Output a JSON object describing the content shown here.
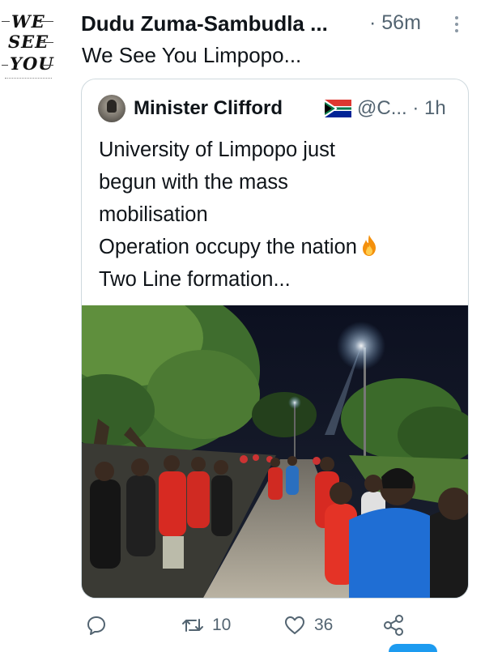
{
  "tweet": {
    "avatar": {
      "logo_text": [
        "WE",
        "SEE",
        "YOU"
      ]
    },
    "author": "Dudu Zuma-Sambudla ...",
    "time": "· 56m",
    "text": "We See You Limpopo..."
  },
  "quoted_tweet": {
    "author": "Minister Clifford",
    "flag_icon": "south-africa-flag",
    "handle_time": "@C... · 1h",
    "lines": [
      "University of Limpopo just",
      "begun with the mass",
      "mobilisation",
      "Operation occupy the nation",
      "Two Line formation..."
    ],
    "emoji_icon": "fire-icon"
  },
  "actions": {
    "reply_icon": "comment-icon",
    "retweets": "10",
    "likes": "36",
    "share_icon": "share-icon"
  },
  "colors": {
    "text": "#0f1419",
    "secondary": "#536471",
    "border": "#cfd9de",
    "accent": "#1d9bf0"
  }
}
